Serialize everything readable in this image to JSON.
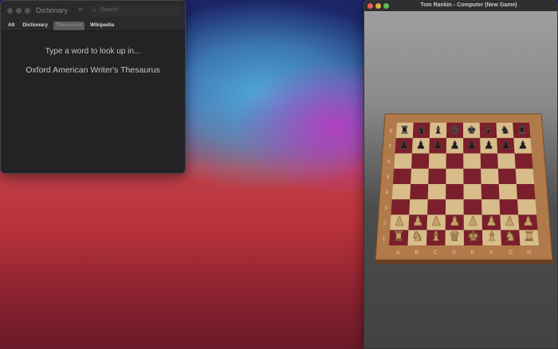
{
  "dictionary": {
    "title": "Dictionary",
    "search_placeholder": "Search",
    "tabs": [
      "All",
      "Dictionary",
      "Thesaurus",
      "Wikipedia"
    ],
    "selected_tab": "Thesaurus",
    "prompt": "Type a word to look up in...",
    "source": "Oxford American Writer's Thesaurus"
  },
  "chess": {
    "title": "Tom Rankin - Computer   (New Game)",
    "files": [
      "A",
      "B",
      "C",
      "D",
      "E",
      "F",
      "G",
      "H"
    ],
    "ranks": [
      "1",
      "2",
      "3",
      "4",
      "5",
      "6",
      "7",
      "8"
    ],
    "black_back_rank": [
      "♜",
      "♞",
      "♝",
      "♛",
      "♚",
      "♝",
      "♞",
      "♜"
    ],
    "white_back_rank": [
      "♜",
      "♞",
      "♝",
      "♛",
      "♚",
      "♝",
      "♞",
      "♜"
    ],
    "pawn": "♟"
  },
  "colors": {
    "close": "#ec5f57",
    "minimize": "#e0b03c",
    "zoom": "#5fc150",
    "dark_square": "#7a1f2b",
    "light_square": "#d8bd8a",
    "frame": "#b07a4a"
  }
}
